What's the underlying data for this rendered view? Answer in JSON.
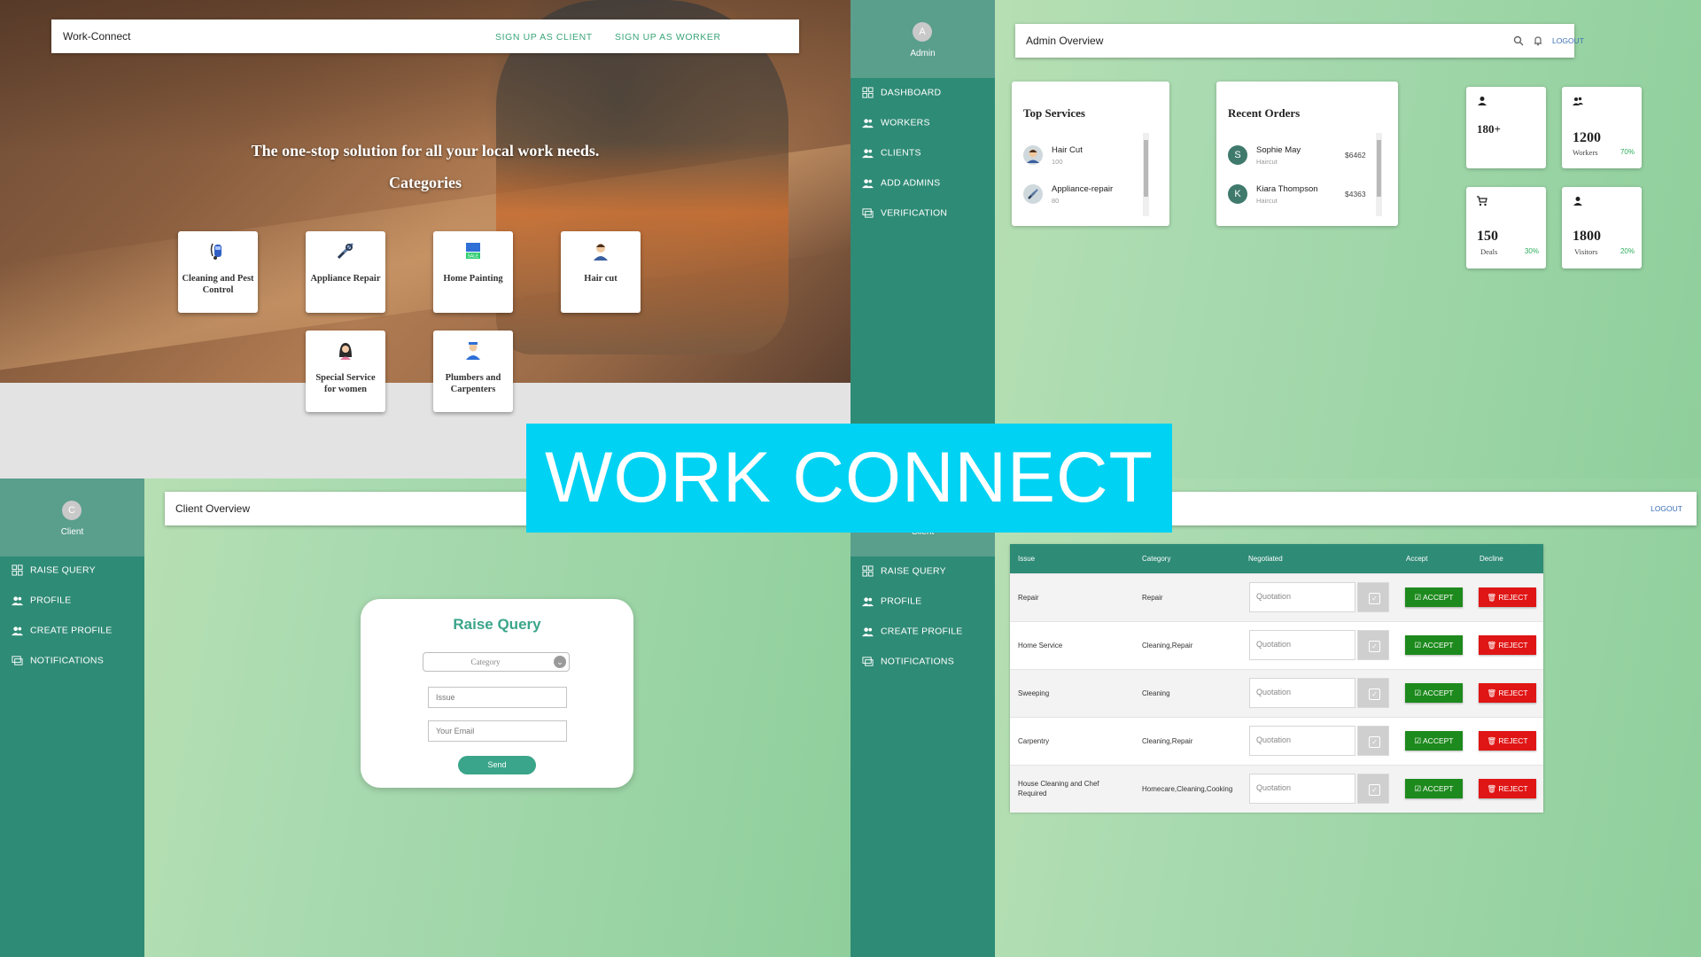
{
  "landing": {
    "brand": "Work-Connect",
    "signup_client": "SIGN UP AS CLIENT",
    "signup_worker": "SIGN UP AS WORKER",
    "tagline": "The one-stop solution for all your local work needs.",
    "categories_heading": "Categories",
    "categories": [
      {
        "label": "Cleaning and Pest Control",
        "icon": "vacuum-cleaner-icon"
      },
      {
        "label": "Appliance Repair",
        "icon": "tools-icon"
      },
      {
        "label": "Home Painting",
        "icon": "paint-sale-icon"
      },
      {
        "label": "Hair cut",
        "icon": "barber-icon"
      },
      {
        "label": "Special Service for women",
        "icon": "woman-icon"
      },
      {
        "label": "Plumbers and Carpenters",
        "icon": "plumber-icon"
      }
    ]
  },
  "admin": {
    "avatar_letter": "A",
    "avatar_label": "Admin",
    "nav": [
      "DASHBOARD",
      "WORKERS",
      "CLIENTS",
      "ADD ADMINS",
      "VERIFICATION"
    ],
    "title": "Admin Overview",
    "logout": "LOGOUT",
    "top_services": {
      "heading": "Top Services",
      "items": [
        {
          "name": "Hair Cut",
          "count": "100"
        },
        {
          "name": "Appliance-repair",
          "count": "80"
        }
      ]
    },
    "recent_orders": {
      "heading": "Recent Orders",
      "items": [
        {
          "initial": "S",
          "name": "Sophie May",
          "service": "Haircut",
          "amount": "$6462"
        },
        {
          "initial": "K",
          "name": "Kiara Thompson",
          "service": "Haircut",
          "amount": "$4363"
        }
      ]
    },
    "stats": [
      {
        "value": "180+",
        "label": "",
        "percent": "",
        "icon": "person-icon"
      },
      {
        "value": "1200",
        "label": "Workers",
        "percent": "70%",
        "icon": "people-icon"
      },
      {
        "value": "150",
        "label": "Deals",
        "percent": "30%",
        "icon": "cart-icon"
      },
      {
        "value": "1800",
        "label": "Visitors",
        "percent": "20%",
        "icon": "person-icon"
      }
    ]
  },
  "client": {
    "avatar_letter": "C",
    "avatar_label": "Client",
    "nav": [
      "RAISE QUERY",
      "PROFILE",
      "CREATE PROFILE",
      "NOTIFICATIONS"
    ],
    "title": "Client Overview",
    "form": {
      "title": "Raise Query",
      "category_placeholder": "Category",
      "issue_placeholder": "Issue",
      "email_placeholder": "Your Email",
      "send": "Send"
    }
  },
  "client_orders": {
    "avatar_label": "Client",
    "nav": [
      "RAISE QUERY",
      "PROFILE",
      "CREATE PROFILE",
      "NOTIFICATIONS"
    ],
    "logout": "LOGOUT",
    "columns": {
      "issue": "Issue",
      "category": "Category",
      "negotiated": "Negotiated",
      "accept": "Accept",
      "decline": "Decline"
    },
    "quote_placeholder": "Quotation",
    "accept_label": "ACCEPT",
    "reject_label": "REJECT",
    "rows": [
      {
        "issue": "Repair",
        "category": "Repair"
      },
      {
        "issue": "Home Service",
        "category": "Cleaning,Repair"
      },
      {
        "issue": "Sweeping",
        "category": "Cleaning"
      },
      {
        "issue": "Carpentry",
        "category": "Cleaning,Repair"
      },
      {
        "issue": "House Cleaning and Chef Required",
        "category": "Homecare,Cleaning,Cooking"
      }
    ]
  },
  "overlay_title": "WORK CONNECT",
  "colors": {
    "sidebar": "#2e8b76",
    "accent": "#3aa58a",
    "overlay": "#00d2f3",
    "accept": "#1d8a1d",
    "reject": "#e01515"
  }
}
